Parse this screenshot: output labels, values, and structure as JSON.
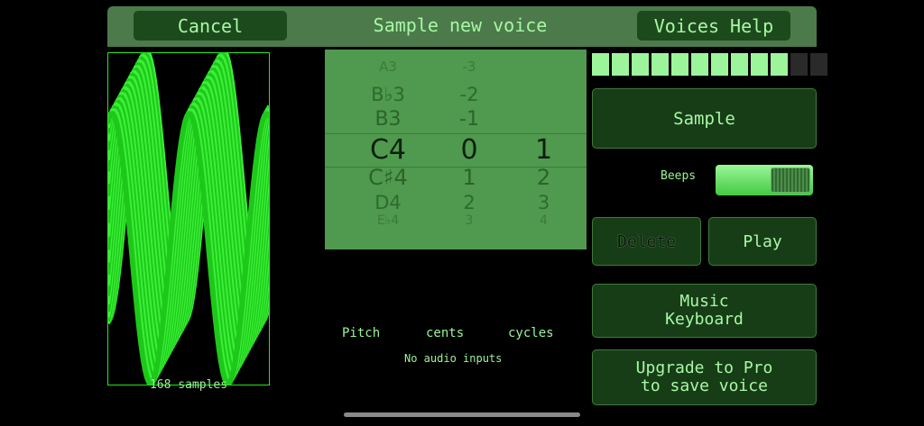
{
  "header": {
    "cancel_label": "Cancel",
    "title": "Sample new voice",
    "help_label": "Voices Help"
  },
  "waveform": {
    "samples_label": "168 samples"
  },
  "picker": {
    "pitch": [
      "A3",
      "B♭3",
      "B3",
      "C4",
      "C♯4",
      "D4",
      "E♭4"
    ],
    "cents": [
      "-3",
      "-2",
      "-1",
      "0",
      "1",
      "2",
      "3"
    ],
    "cycles": [
      "",
      "",
      "",
      "1",
      "2",
      "3",
      "4"
    ],
    "selected_index": 3
  },
  "level_meter": {
    "segments_total": 12,
    "segments_lit": 10
  },
  "controls": {
    "sample_label": "Sample",
    "beeps_label": "Beeps",
    "beeps_on": true,
    "delete_label": "Delete",
    "play_label": "Play",
    "music_keyboard_line1": "Music",
    "music_keyboard_line2": "Keyboard",
    "upgrade_line1": "Upgrade to Pro",
    "upgrade_line2": "to save voice"
  },
  "labels": {
    "pitch": "Pitch",
    "cents": "cents",
    "cycles": "cycles",
    "status": "No audio inputs"
  },
  "colors": {
    "accent": "#9cf59a",
    "bright_green": "#22e81c",
    "button_bg": "#173d17",
    "picker_bg": "#4f9a4e"
  }
}
